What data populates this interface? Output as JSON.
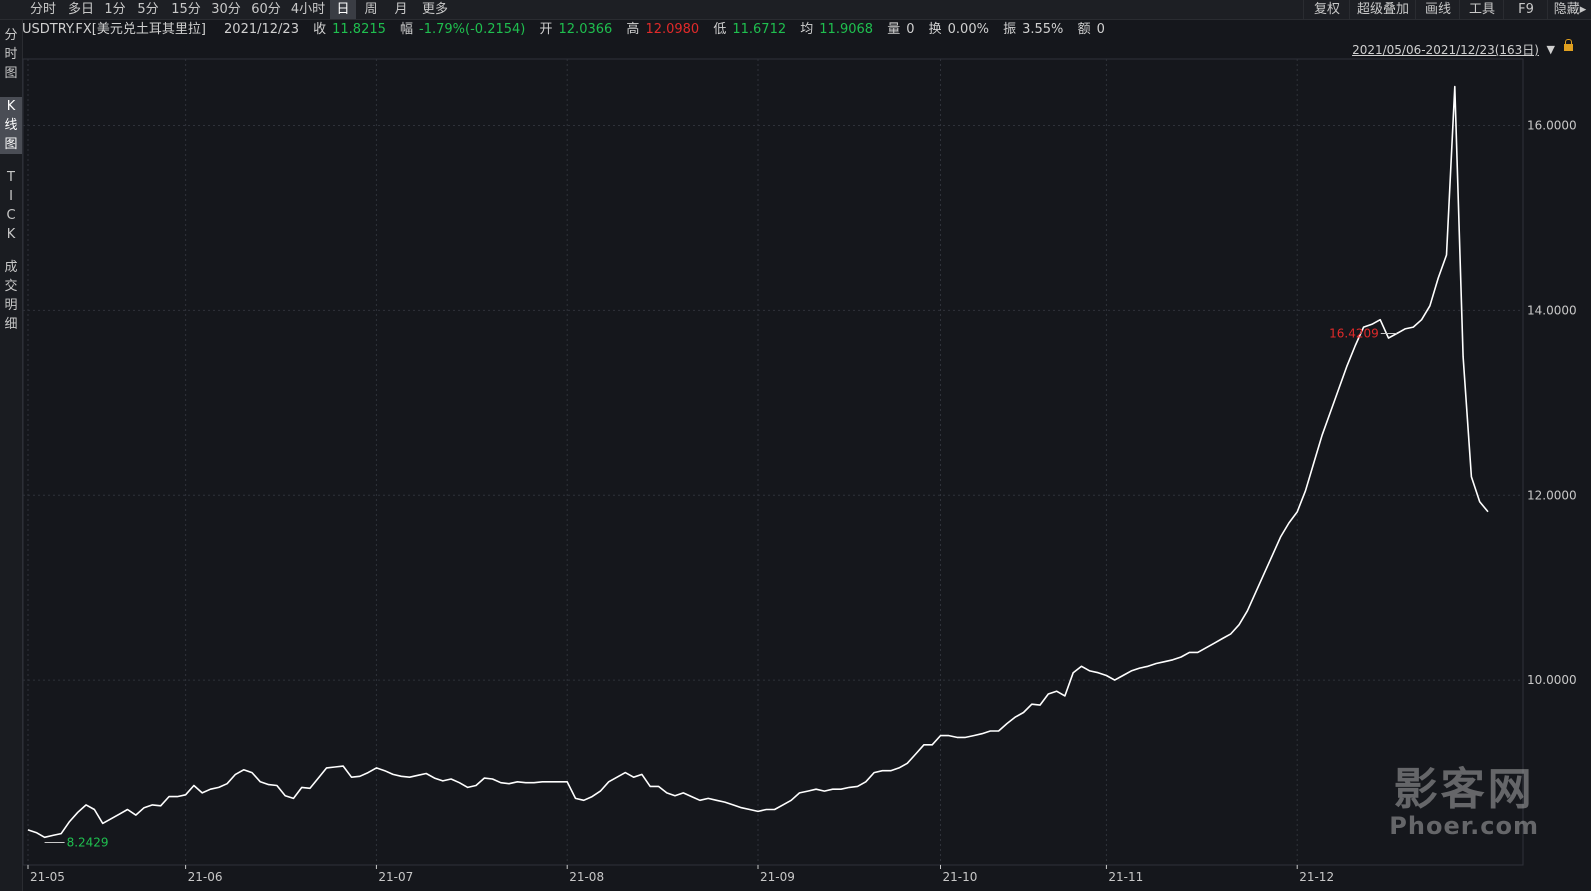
{
  "toolbar": {
    "periods": [
      "分时",
      "多日",
      "1分",
      "5分",
      "15分",
      "30分",
      "60分",
      "4小时",
      "日",
      "周",
      "月",
      "更多"
    ],
    "active_period": "日",
    "right_tools": [
      "复权",
      "超级叠加",
      "画线",
      "工具",
      "F9",
      "隐藏"
    ]
  },
  "sidebar": {
    "tabs": [
      "分时图",
      "K线图",
      "TICK",
      "成交明细"
    ],
    "active": "K线图"
  },
  "info": {
    "symbol": "USDTRY.FX[美元兑土耳其里拉]",
    "date": "2021/12/23",
    "close_label": "收",
    "close": "11.8215",
    "change_label": "幅",
    "change": "-1.79%(-0.2154)",
    "open_label": "开",
    "open": "12.0366",
    "high_label": "高",
    "high": "12.0980",
    "low_label": "低",
    "low": "11.6712",
    "avg_label": "均",
    "avg": "11.9068",
    "volume_label": "量",
    "volume": "0",
    "turnover_label": "换",
    "turnover": "0.00%",
    "amplitude_label": "振",
    "amplitude": "3.55%",
    "amount_label": "额",
    "amount": "0"
  },
  "range_label": "2021/05/06-2021/12/23(163日)",
  "watermark": {
    "line1": "影客网",
    "line2": "Phoer.com"
  },
  "colors": {
    "background": "#15171c",
    "line": "#ffffff",
    "grid": "#2f323a",
    "up": "#e02a2a",
    "down": "#1fbf4f"
  },
  "chart_data": {
    "type": "line",
    "ylim": [
      8.0,
      16.72
    ],
    "yticks": [
      10,
      12,
      14,
      16
    ],
    "ytick_labels": [
      "10.0000",
      "12.0000",
      "14.0000",
      "16.0000"
    ],
    "xtick_labels": [
      "21-05",
      "21-06",
      "21-07",
      "21-08",
      "21-09",
      "21-10",
      "21-11",
      "21-12"
    ],
    "xtick_index": [
      0,
      19,
      42,
      65,
      88,
      110,
      130,
      153
    ],
    "grid": true,
    "max_label": "16.4209",
    "max_index": 165,
    "min_label": "8.2429",
    "min_index": 2,
    "values": [
      8.38,
      8.35,
      8.3,
      8.32,
      8.34,
      8.47,
      8.57,
      8.65,
      8.6,
      8.45,
      8.5,
      8.55,
      8.6,
      8.54,
      8.62,
      8.65,
      8.64,
      8.74,
      8.74,
      8.76,
      8.86,
      8.78,
      8.82,
      8.84,
      8.88,
      8.98,
      9.03,
      9.0,
      8.9,
      8.87,
      8.86,
      8.75,
      8.72,
      8.84,
      8.83,
      8.94,
      9.05,
      9.06,
      9.07,
      8.95,
      8.96,
      9.0,
      9.05,
      9.02,
      8.98,
      8.96,
      8.95,
      8.97,
      8.99,
      8.94,
      8.91,
      8.93,
      8.89,
      8.84,
      8.86,
      8.94,
      8.93,
      8.89,
      8.88,
      8.9,
      8.89,
      8.89,
      8.9,
      8.9,
      8.9,
      8.9,
      8.72,
      8.7,
      8.74,
      8.8,
      8.9,
      8.95,
      9.0,
      8.95,
      8.98,
      8.85,
      8.85,
      8.78,
      8.75,
      8.78,
      8.74,
      8.7,
      8.72,
      8.7,
      8.68,
      8.65,
      8.62,
      8.6,
      8.58,
      8.6,
      8.6,
      8.65,
      8.7,
      8.78,
      8.8,
      8.82,
      8.8,
      8.82,
      8.82,
      8.84,
      8.85,
      8.9,
      9.0,
      9.02,
      9.02,
      9.05,
      9.1,
      9.2,
      9.3,
      9.3,
      9.4,
      9.4,
      9.38,
      9.38,
      9.4,
      9.42,
      9.45,
      9.45,
      9.53,
      9.6,
      9.65,
      9.74,
      9.73,
      9.85,
      9.88,
      9.83,
      10.08,
      10.15,
      10.1,
      10.08,
      10.05,
      10.0,
      10.05,
      10.1,
      10.13,
      10.15,
      10.18,
      10.2,
      10.22,
      10.25,
      10.3,
      10.3,
      10.35,
      10.4,
      10.45,
      10.5,
      10.6,
      10.75,
      10.95,
      11.15,
      11.35,
      11.55,
      11.7,
      11.82,
      12.05,
      12.35,
      12.65,
      12.9,
      13.15,
      13.4,
      13.62,
      13.82,
      13.85,
      13.9,
      13.7,
      13.75,
      13.8,
      13.82,
      13.9,
      14.05,
      14.35,
      14.6,
      16.4209,
      13.5,
      12.2,
      11.93,
      11.8215
    ]
  }
}
